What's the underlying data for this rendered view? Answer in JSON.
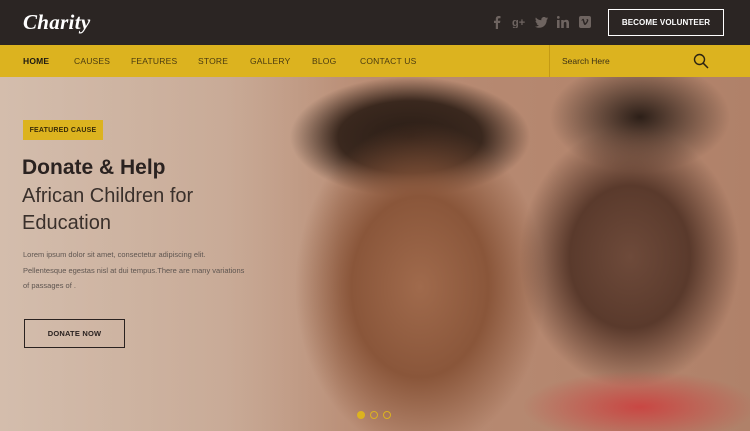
{
  "brand": {
    "logo_text": "Charity"
  },
  "header": {
    "social_icons": [
      "facebook-icon",
      "google-plus-icon",
      "twitter-icon",
      "linkedin-icon",
      "vimeo-icon"
    ],
    "volunteer_button": "BECOME VOLUNTEER"
  },
  "nav": {
    "items": [
      {
        "label": "HOME",
        "active": true
      },
      {
        "label": "CAUSES",
        "active": false
      },
      {
        "label": "FEATURES",
        "active": false
      },
      {
        "label": "STORE",
        "active": false
      },
      {
        "label": "GALLERY",
        "active": false
      },
      {
        "label": "BLOG",
        "active": false
      },
      {
        "label": "CONTACT US",
        "active": false
      }
    ],
    "search_placeholder": "Search Here"
  },
  "hero": {
    "badge": "FEATURED CAUSE",
    "headline": "Donate & Help",
    "subline": "African Children for Education",
    "description": "Lorem ipsum dolor sit amet, consectetur adipiscing elit. Pellentesque egestas nisl at dui tempus.There are many variations of passages of .",
    "button": "DONATE NOW",
    "slides": {
      "total": 3,
      "active_index": 0
    }
  },
  "colors": {
    "accent": "#dcb31f",
    "header_bg": "#2b2523",
    "text_dark": "#2a2220"
  }
}
